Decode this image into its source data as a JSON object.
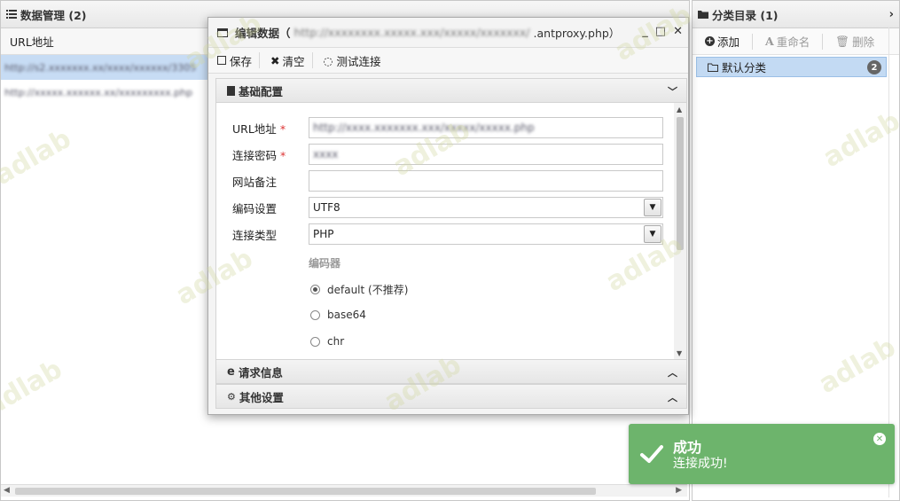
{
  "left_panel": {
    "title": "数据管理 (2)",
    "column_header": "URL地址",
    "rows": [
      {
        "url": "http://s2.xxxxxxx.xx/xxxx/xxxxxx/3305",
        "selected": true
      },
      {
        "url": "http://xxxxx.xxxxxx.xx/xxxxxxxxx.php",
        "selected": false
      }
    ]
  },
  "right_panel": {
    "title": "分类目录 (1)",
    "add_label": "添加",
    "rename_label": "重命名",
    "delete_label": "删除",
    "categories": [
      {
        "name": "默认分类",
        "count": "2"
      }
    ]
  },
  "dialog": {
    "title_prefix": "编辑数据（",
    "title_blurred": "http://xxxxxxxx.xxxxx.xxx/xxxxx/xxxxxxx/",
    "title_file": ".antproxy.php）",
    "toolbar": {
      "save_label": "保存",
      "clear_label": "清空",
      "test_label": "测试连接"
    },
    "section_basic": "基础配置",
    "section_request": "请求信息",
    "section_other": "其他设置",
    "form": {
      "url_label": "URL地址",
      "url_value": "http://xxxx.xxxxxxx.xxx/xxxxx/xxxxx.php",
      "password_label": "连接密码",
      "password_value": "xxxx",
      "note_label": "网站备注",
      "note_value": "",
      "encoding_label": "编码设置",
      "encoding_value": "UTF8",
      "type_label": "连接类型",
      "type_value": "PHP",
      "encoder_title": "编码器",
      "encoders": [
        {
          "label": "default (不推荐)",
          "checked": true
        },
        {
          "label": "base64",
          "checked": false
        },
        {
          "label": "chr",
          "checked": false
        }
      ]
    }
  },
  "toast": {
    "title": "成功",
    "message": "连接成功!",
    "color": "#6db46c"
  },
  "watermark_text": "adlab"
}
